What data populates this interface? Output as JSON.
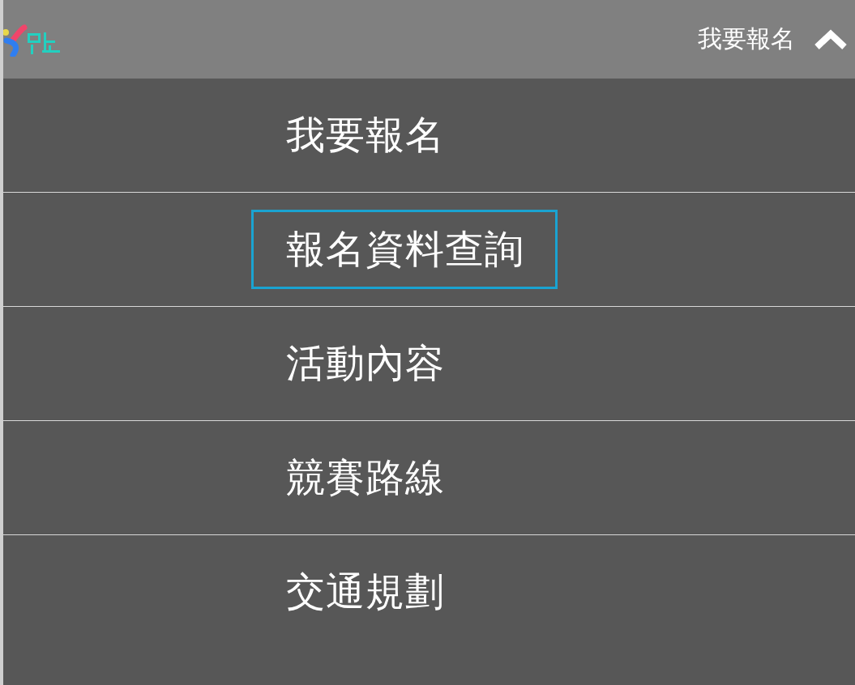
{
  "header": {
    "title": "我要報名",
    "expanded": true
  },
  "menu": [
    {
      "label": "我要報名",
      "selected": false
    },
    {
      "label": "報名資料查詢",
      "selected": true
    },
    {
      "label": "活動內容",
      "selected": false
    },
    {
      "label": "競賽路線",
      "selected": false
    },
    {
      "label": "交通規劃",
      "selected": false
    }
  ]
}
